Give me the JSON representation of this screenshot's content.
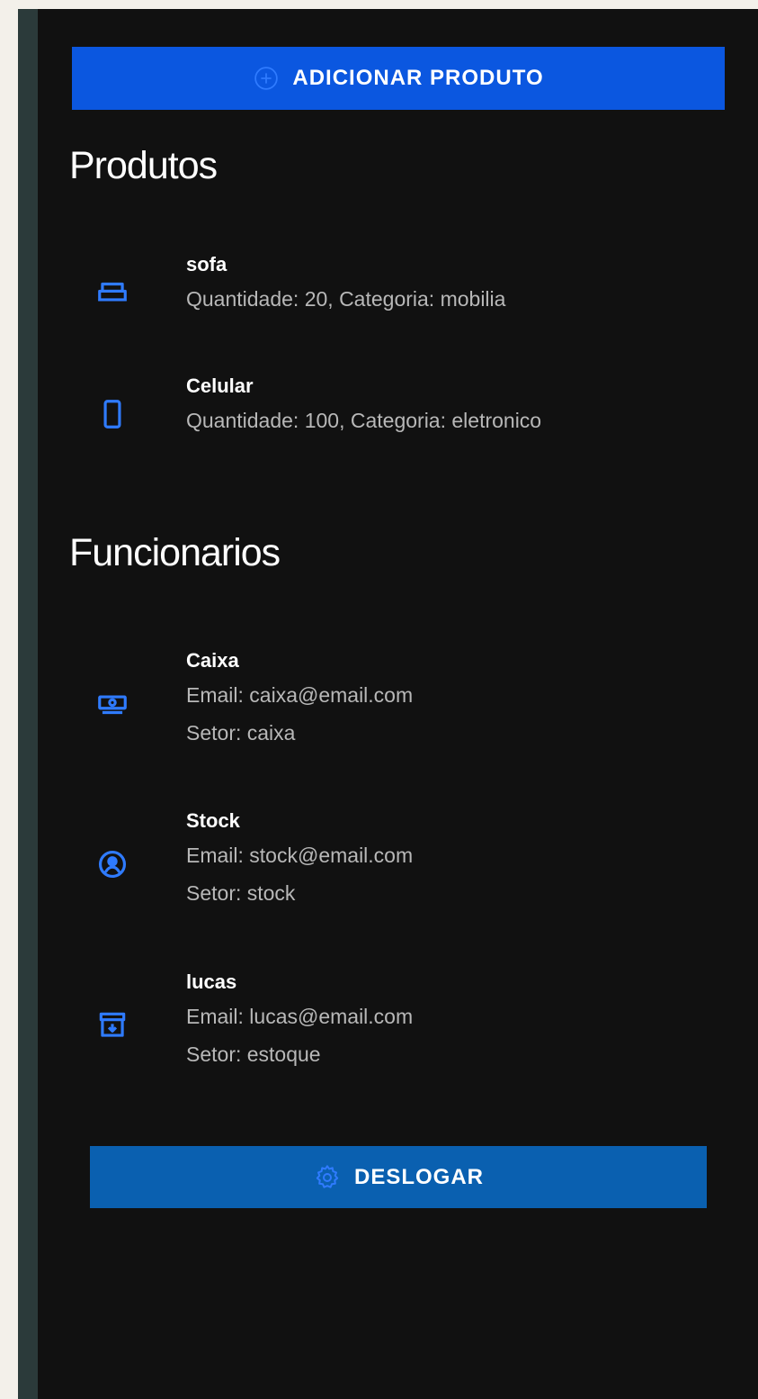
{
  "actions": {
    "add_product_label": "ADICIONAR PRODUTO",
    "logout_label": "DESLOGAR"
  },
  "produtos": {
    "title": "Produtos",
    "items": [
      {
        "name": "sofa",
        "details": "Quantidade: 20, Categoria: mobilia",
        "icon": "sofa-icon"
      },
      {
        "name": "Celular",
        "details": "Quantidade: 100, Categoria: eletronico",
        "icon": "smartphone-icon"
      }
    ]
  },
  "funcionarios": {
    "title": "Funcionarios",
    "items": [
      {
        "name": "Caixa",
        "email": "Email: caixa@email.com",
        "setor": "Setor: caixa",
        "icon": "cash-register-icon"
      },
      {
        "name": "Stock",
        "email": "Email: stock@email.com",
        "setor": "Setor: stock",
        "icon": "account-circle-icon"
      },
      {
        "name": "lucas",
        "email": "Email: lucas@email.com",
        "setor": "Setor: estoque",
        "icon": "archive-box-icon"
      }
    ]
  },
  "colors": {
    "accent": "#0b57e0",
    "logout": "#0a60b0",
    "icon": "#2f7bff",
    "background": "#111111"
  }
}
